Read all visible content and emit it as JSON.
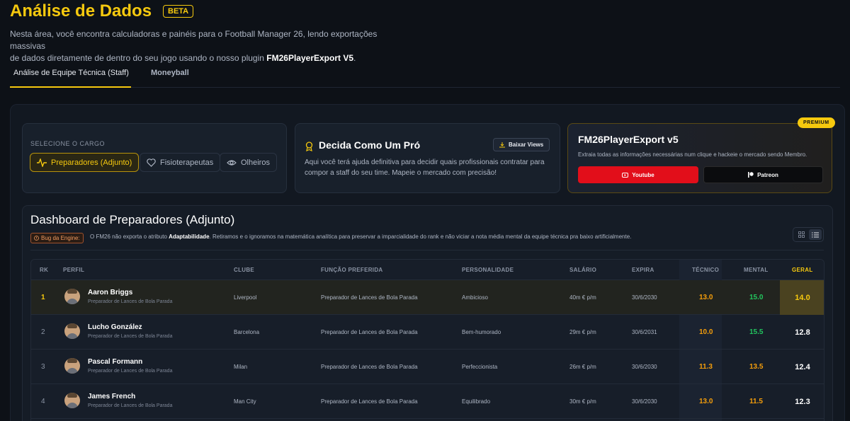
{
  "header": {
    "title": "Análise de Dados",
    "badge": "BETA",
    "intro_line1": "Nesta área, você encontra calculadoras e painéis para o Football Manager 26, lendo exportações massivas",
    "intro_line2_pre": "de dados diretamente de dentro do seu jogo usando o nosso plugin ",
    "intro_plugin": "FM26PlayerExport V5",
    "intro_line2_post": "."
  },
  "tabs": [
    {
      "label": "Análise de Equipe Técnica (Staff)",
      "active": true
    },
    {
      "label": "Moneyball",
      "active": false
    }
  ],
  "role_selector": {
    "label": "SELECIONE O CARGO",
    "options": [
      {
        "label": "Preparadores (Adjunto)",
        "icon": "pulse-icon",
        "active": true
      },
      {
        "label": "Fisioterapeutas",
        "icon": "heart-icon",
        "active": false
      },
      {
        "label": "Olheiros",
        "icon": "eye-icon",
        "active": false
      }
    ]
  },
  "pro_card": {
    "title": "Decida Como Um Pró",
    "button": "Baixar Views",
    "text_line1": "Aqui você terá ajuda definitiva para decidir quais profissionais contratar para",
    "text_line2": "compor a staff do seu time. Mapeie o mercado com precisão!"
  },
  "premium_card": {
    "badge": "PREMIUM",
    "title": "FM26PlayerExport v5",
    "text": "Extraia todas as informações necessárias num clique e hackeie o mercado sendo Membro.",
    "youtube": "Youtube",
    "patreon": "Patreon"
  },
  "dashboard": {
    "title": "Dashboard de Preparadores (Adjunto)",
    "bug_label": "Bug da Engine:",
    "bug_pre": "O FM26 não exporta o atributo ",
    "bug_attr": "Adaptabilidade",
    "bug_post": ". Retiramos e o ignoramos na matemática analítica para preservar a imparcialidade do rank e não viciar a nota média mental da equipe técnica pra baixo artificialmente."
  },
  "table": {
    "columns": [
      "RK",
      "PERFIL",
      "CLUBE",
      "FUNÇÃO PREFERIDA",
      "PERSONALIDADE",
      "SALÁRIO",
      "EXPIRA",
      "TÉCNICO",
      "MENTAL",
      "GERAL"
    ],
    "rows": [
      {
        "rk": "1",
        "name": "Aaron Briggs",
        "role": "Preparador de Lances de Bola Parada",
        "club": "Liverpool",
        "funcao": "Preparador de Lances de Bola Parada",
        "personalidade": "Ambicioso",
        "salario": "40m € p/m",
        "expira": "30/6/2030",
        "tecnico": "13.0",
        "mental": "15.0",
        "geral": "14.0"
      },
      {
        "rk": "2",
        "name": "Lucho González",
        "role": "Preparador de Lances de Bola Parada",
        "club": "Barcelona",
        "funcao": "Preparador de Lances de Bola Parada",
        "personalidade": "Bem-humorado",
        "salario": "29m € p/m",
        "expira": "30/6/2031",
        "tecnico": "10.0",
        "mental": "15.5",
        "geral": "12.8"
      },
      {
        "rk": "3",
        "name": "Pascal Formann",
        "role": "Preparador de Lances de Bola Parada",
        "club": "Milan",
        "funcao": "Preparador de Lances de Bola Parada",
        "personalidade": "Perfeccionista",
        "salario": "26m € p/m",
        "expira": "30/6/2030",
        "tecnico": "11.3",
        "mental": "13.5",
        "geral": "12.4"
      },
      {
        "rk": "4",
        "name": "James French",
        "role": "Preparador de Lances de Bola Parada",
        "club": "Man City",
        "funcao": "Preparador de Lances de Bola Parada",
        "personalidade": "Equilibrado",
        "salario": "30m € p/m",
        "expira": "30/6/2030",
        "tecnico": "13.0",
        "mental": "11.5",
        "geral": "12.3"
      }
    ]
  },
  "colors": {
    "accent": "#f6c90e",
    "mental_high": "#22c55e",
    "mental_mid": "#f59e0b",
    "tecnico": "#f59e0b"
  }
}
